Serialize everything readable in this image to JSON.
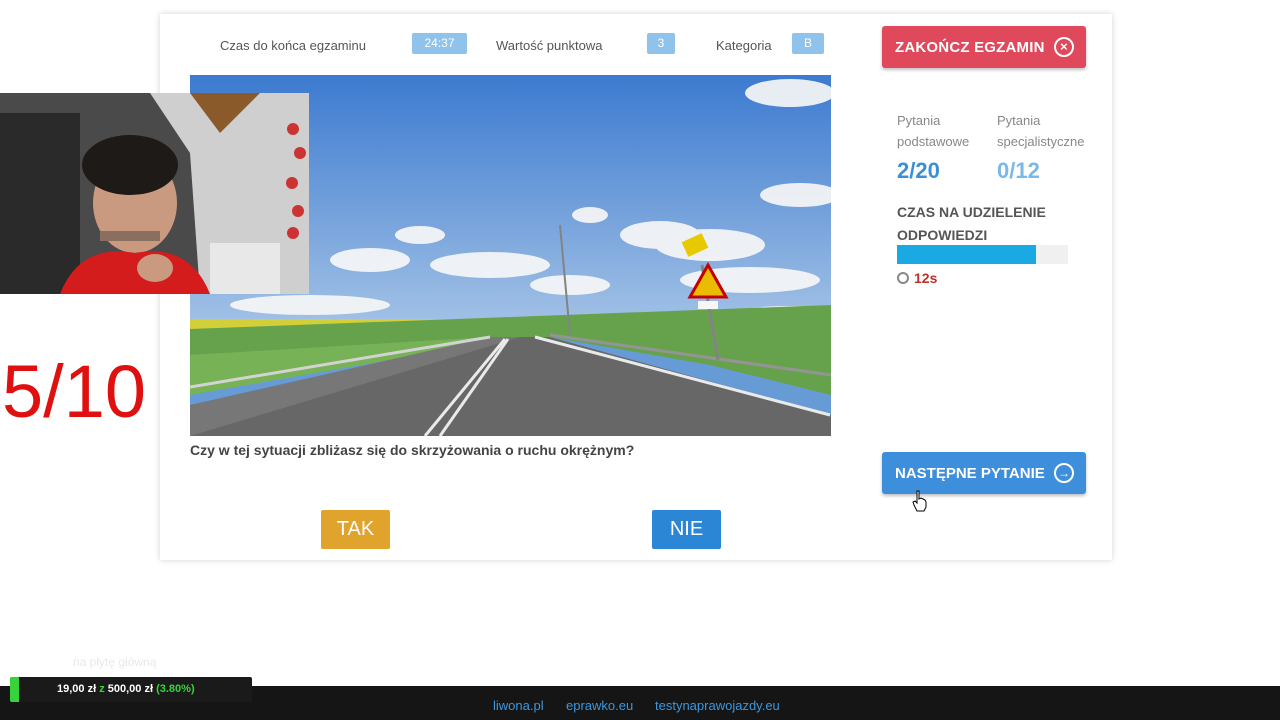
{
  "header": {
    "time_label": "Czas do końca egzaminu",
    "time_value": "24:37",
    "points_label": "Wartość punktowa",
    "points_value": "3",
    "category_label": "Kategoria",
    "category_value": "B",
    "end_button": "ZAKOŃCZ EGZAMIN"
  },
  "question": {
    "text": "Czy w tej sytuacji zbliżasz się do skrzyżowania o ruchu okrężnym?",
    "yes_label": "TAK",
    "no_label": "NIE"
  },
  "stats": {
    "basic_label_1": "Pytania",
    "basic_label_2": "podstawowe",
    "basic_value": "2/20",
    "special_label_1": "Pytania",
    "special_label_2": "specjalistyczne",
    "special_value": "0/12",
    "answer_time_label": "CZAS NA UDZIELENIE ODPOWIEDZI",
    "answer_time_progress": 0.81,
    "answer_time_value": "12s"
  },
  "next_button": "NASTĘPNE PYTANIE",
  "overlay": {
    "score": "5/10",
    "ghost_text": "na płytę główną",
    "donation_current": "19,00 zł",
    "donation_sep": "z",
    "donation_goal": "500,00 zł",
    "donation_pct": "(3.80%)",
    "donation_progress": 0.038
  },
  "footer": {
    "links": [
      "liwona.pl",
      "eprawko.eu",
      "testynaprawojazdy.eu"
    ]
  },
  "colors": {
    "end_button": "#e0485c",
    "next_button": "#3d8fdc",
    "yes_button": "#e0a32b",
    "no_button": "#2c86d6",
    "progress": "#1aa9e3",
    "score": "#e01010"
  }
}
